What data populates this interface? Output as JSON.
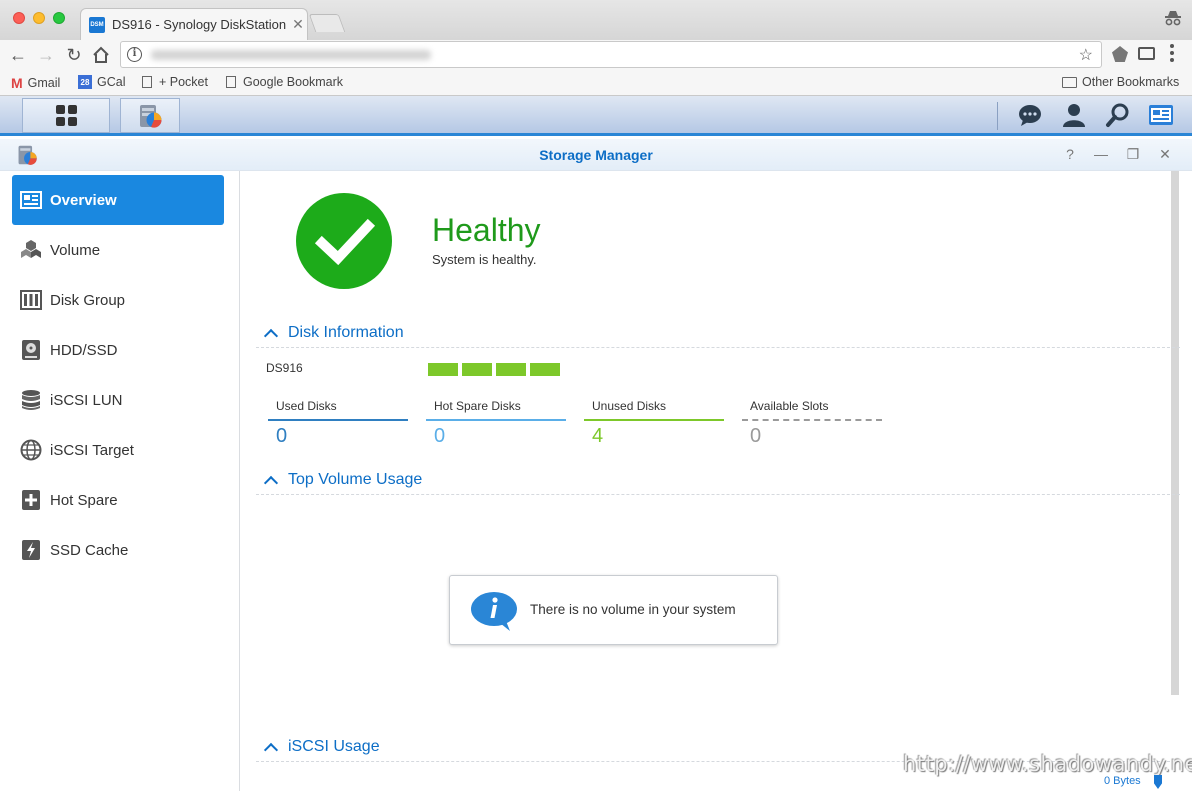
{
  "browser": {
    "tab_title": "DS916 - Synology DiskStation",
    "tab_favicon": "DSM",
    "bookmarks": [
      {
        "label": "Gmail",
        "icon": "gmail-icon"
      },
      {
        "label": "GCal",
        "icon": "gcal-icon",
        "badge": "28"
      },
      {
        "label": "+ Pocket",
        "icon": "page-icon"
      },
      {
        "label": "Google Bookmark",
        "icon": "page-icon"
      }
    ],
    "other_bookmarks": "Other Bookmarks"
  },
  "window": {
    "title": "Storage Manager",
    "controls": {
      "help": "?",
      "minimize": "—",
      "restore": "❐",
      "close": "✕"
    }
  },
  "sidebar": {
    "items": [
      {
        "label": "Overview",
        "icon": "overview-icon",
        "active": true
      },
      {
        "label": "Volume",
        "icon": "volume-icon"
      },
      {
        "label": "Disk Group",
        "icon": "disk-group-icon"
      },
      {
        "label": "HDD/SSD",
        "icon": "hdd-icon"
      },
      {
        "label": "iSCSI LUN",
        "icon": "iscsi-lun-icon"
      },
      {
        "label": "iSCSI Target",
        "icon": "iscsi-target-icon"
      },
      {
        "label": "Hot Spare",
        "icon": "hot-spare-icon"
      },
      {
        "label": "SSD Cache",
        "icon": "ssd-cache-icon"
      }
    ]
  },
  "health": {
    "status": "Healthy",
    "description": "System is healthy.",
    "color": "#1dab1a"
  },
  "disk_info": {
    "heading": "Disk Information",
    "device": "DS916",
    "slots_filled": 4,
    "slot_color": "#7dc82a",
    "stats": [
      {
        "label": "Used Disks",
        "value": "0",
        "color": "#2f7fc1"
      },
      {
        "label": "Hot Spare Disks",
        "value": "0",
        "color": "#5aaee8"
      },
      {
        "label": "Unused Disks",
        "value": "4",
        "color": "#7dc82a"
      },
      {
        "label": "Available Slots",
        "value": "0",
        "color": "#9a9a9a"
      }
    ]
  },
  "volume_usage": {
    "heading": "Top Volume Usage",
    "empty_message": "There is no volume in your system"
  },
  "iscsi_usage": {
    "heading": "iSCSI Usage",
    "value": "0 Bytes"
  },
  "watermark": "http://www.shadowandy.net"
}
